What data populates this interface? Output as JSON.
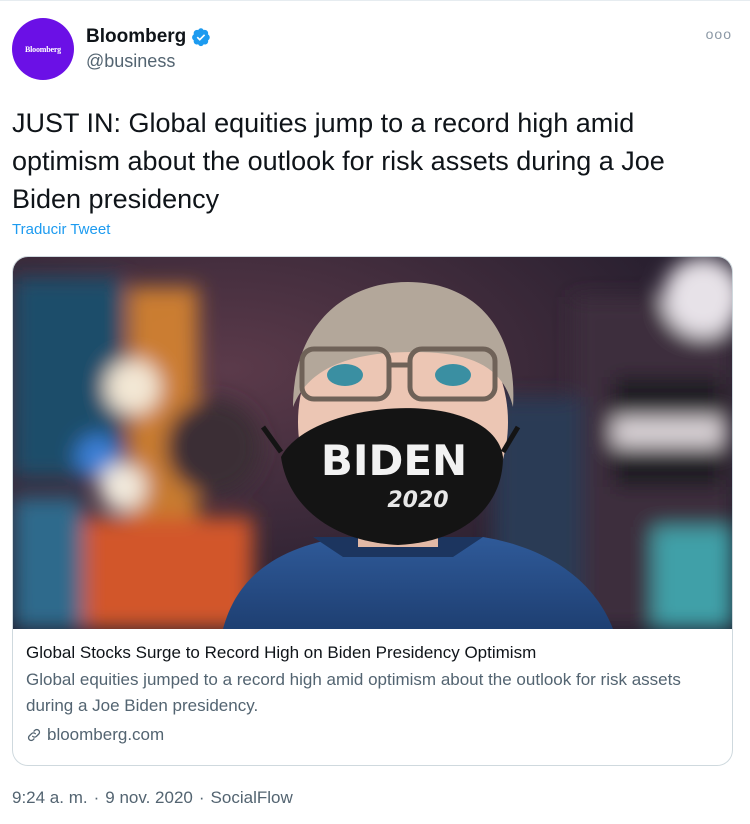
{
  "account": {
    "display_name": "Bloomberg",
    "handle": "@business",
    "avatar_text": "Bloomberg",
    "avatar_color": "#6b10e6",
    "verified": true
  },
  "tweet": {
    "text": "JUST IN: Global equities jump to a record high amid optimism about the outlook for risk assets during a Joe Biden presidency",
    "translate_label": "Traducir Tweet"
  },
  "card": {
    "image_mask_text": "BIDEN",
    "image_mask_year": "2020",
    "title": "Global Stocks Surge to Record High on Biden Presidency Optimism",
    "description": "Global equities jumped to a record high amid optimism about the outlook for risk assets during a Joe Biden presidency.",
    "domain": "bloomberg.com"
  },
  "meta": {
    "time": "9:24 a. m.",
    "date": "9 nov. 2020",
    "source": "SocialFlow"
  },
  "colors": {
    "link": "#1d9bf0",
    "secondary_text": "#536471",
    "border": "#cfd9de"
  },
  "icons": [
    "verified-badge-icon",
    "more-options-icon",
    "link-icon"
  ]
}
